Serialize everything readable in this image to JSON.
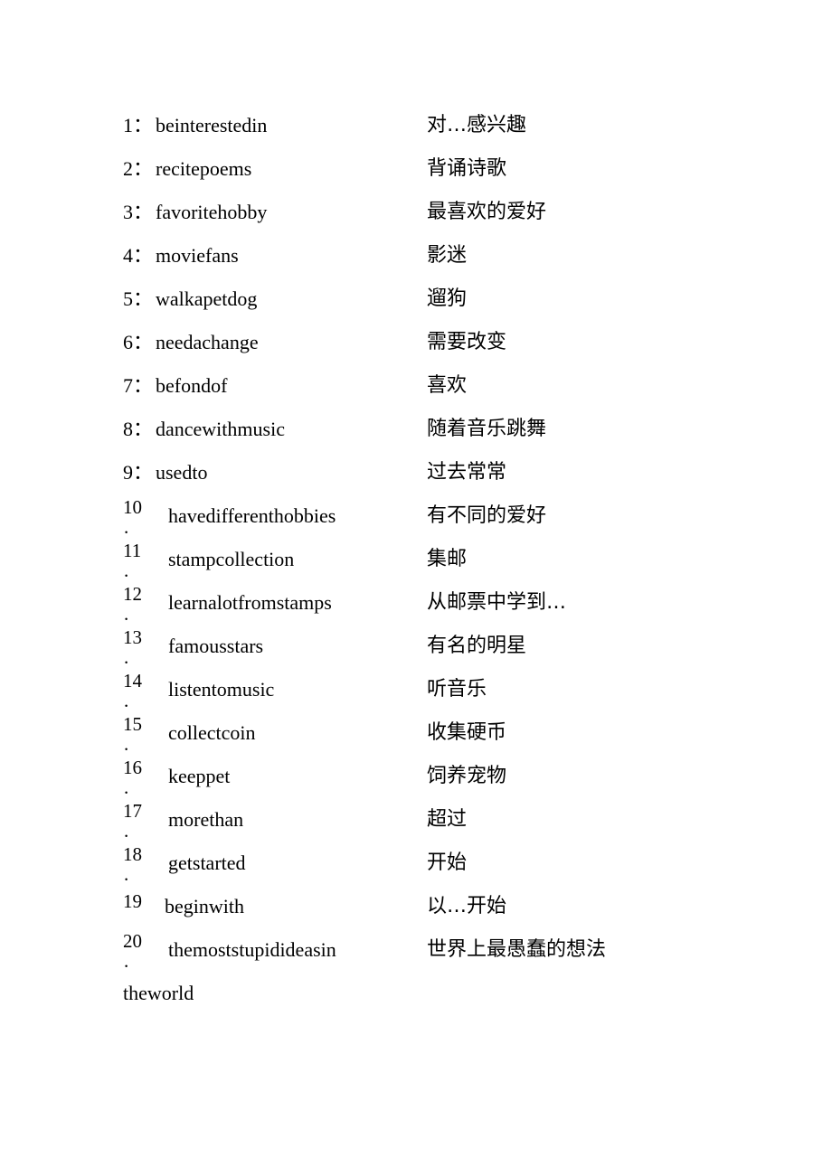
{
  "document": {
    "background_color": "#ffffff",
    "text_color": "#000000",
    "entries": [
      {
        "number": "1：",
        "english": "beinterestedin",
        "chinese": "对…感兴趣"
      },
      {
        "number": "2：",
        "english": "recitepoems",
        "chinese": "背诵诗歌"
      },
      {
        "number": "3：",
        "english": "favoritehobby",
        "chinese": "最喜欢的爱好"
      },
      {
        "number": "4：",
        "english": "moviefans",
        "chinese": "影迷"
      },
      {
        "number": "5：",
        "english": "walkapetdog",
        "chinese": "遛狗"
      },
      {
        "number": "6：",
        "english": "needachange",
        "chinese": "需要改变"
      },
      {
        "number": "7：",
        "english": "befondof",
        "chinese": "喜欢"
      },
      {
        "number": "8：",
        "english": "dancewithmusic",
        "chinese": "随着音乐跳舞"
      },
      {
        "number": "9：",
        "english": "usedto",
        "chinese": "过去常常"
      },
      {
        "number": "10",
        "period": ".",
        "english": "havedifferenthobbies",
        "chinese": "有不同的爱好"
      },
      {
        "number": "11",
        "period": ".",
        "english": "stampcollection",
        "chinese": "集邮"
      },
      {
        "number": "12",
        "period": ".",
        "english": "learnalotfromstamps",
        "chinese": "从邮票中学到…"
      },
      {
        "number": "13",
        "period": ".",
        "english": "famousstars",
        "chinese": "有名的明星"
      },
      {
        "number": "14",
        "period": ".",
        "english": "listentomusic",
        "chinese": "听音乐"
      },
      {
        "number": "15",
        "period": ".",
        "english": "collectcoin",
        "chinese": "收集硬币"
      },
      {
        "number": "16",
        "period": ".",
        "english": "keeppet",
        "chinese": "饲养宠物"
      },
      {
        "number": "17",
        "period": ".",
        "english": "morethan",
        "chinese": "超过"
      },
      {
        "number": "18",
        "period": ".",
        "english": "getstarted",
        "chinese": "开始"
      },
      {
        "number": "19",
        "period": "",
        "english": "beginwith",
        "chinese": "以…开始"
      },
      {
        "number": "20",
        "period": ".",
        "english": "themoststupidideasin",
        "chinese": "世界上最愚蠢的想法"
      }
    ],
    "continuation_line": "theworld"
  }
}
